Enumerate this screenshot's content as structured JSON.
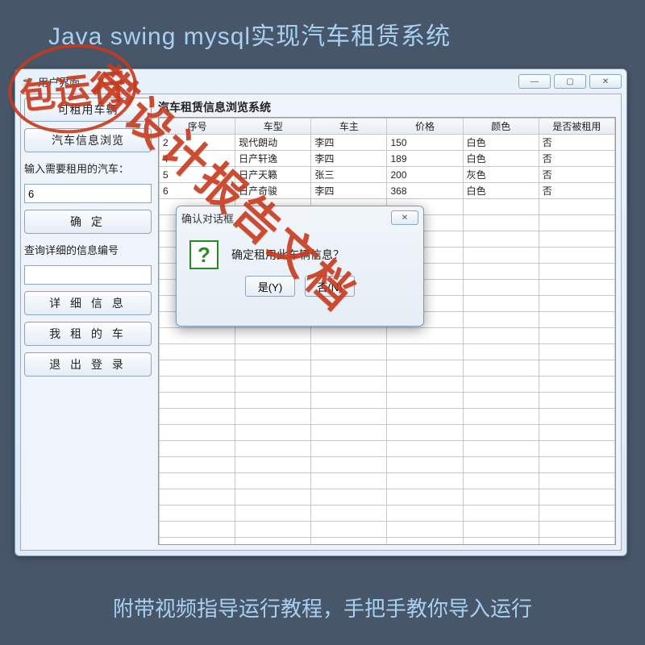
{
  "banner": {
    "top": "Java swing mysql实现汽车租赁系统",
    "bottom": "附带视频指导运行教程，手把手教你导入运行"
  },
  "stamps": {
    "circle": "包运行",
    "diag": "带设计报告文档"
  },
  "window": {
    "title": "用户界面",
    "panel_title": "汽车租赁信息浏览系统",
    "sidebar": {
      "btn_rentable": "可租用车辆",
      "btn_browse": "汽车信息浏览",
      "label_rent": "输入需要租用的汽车：",
      "input_rent_value": "6",
      "btn_confirm": "确    定",
      "label_query": "查询详细的信息编号",
      "input_query_value": "",
      "btn_detail": "详 细 信 息",
      "btn_mycar": "我 租 的 车",
      "btn_logout": "退 出 登 录"
    },
    "table": {
      "headers": [
        "序号",
        "车型",
        "车主",
        "价格",
        "颜色",
        "是否被租用"
      ],
      "rows": [
        [
          "2",
          "现代朗动",
          "李四",
          "150",
          "白色",
          "否"
        ],
        [
          "4",
          "日产轩逸",
          "李四",
          "189",
          "白色",
          "否"
        ],
        [
          "5",
          "日产天籁",
          "张三",
          "200",
          "灰色",
          "否"
        ],
        [
          "6",
          "日产奇骏",
          "李四",
          "368",
          "白色",
          "否"
        ]
      ]
    }
  },
  "dialog": {
    "title": "确认对话框",
    "message": "确定租用此车辆信息？",
    "btn_yes": "是(Y)",
    "btn_no": "否(N)"
  },
  "win_controls": {
    "min": "—",
    "max": "▢",
    "close": "✕"
  }
}
